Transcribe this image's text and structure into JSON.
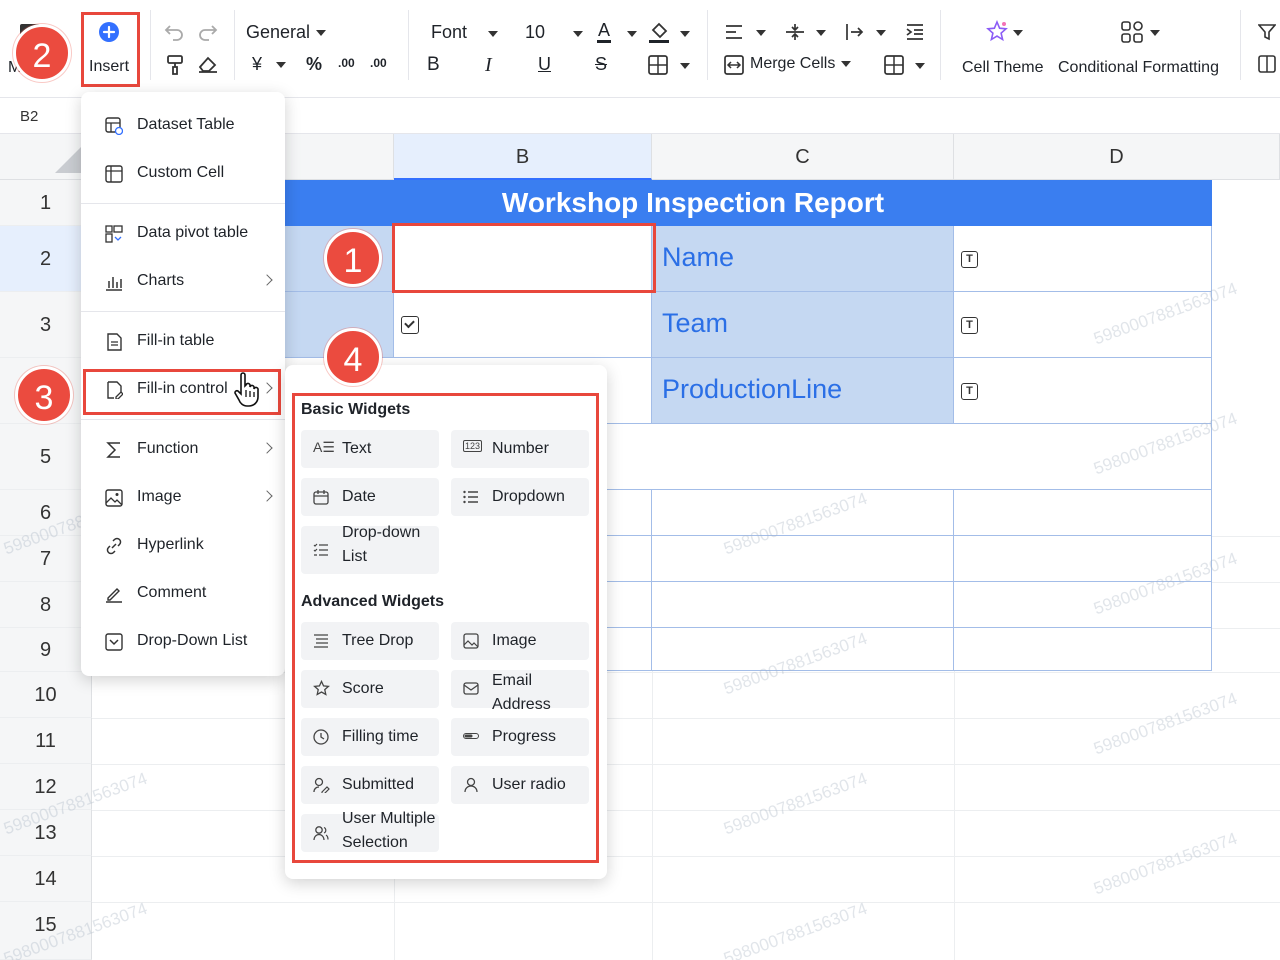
{
  "toolbar": {
    "insert_label": "Insert",
    "m_label": "M",
    "number_format": "General",
    "currency_symbol": "¥",
    "percent_symbol": "%",
    "decimal_decrease": ".00",
    "decimal_increase": ".00",
    "font": "Font",
    "font_size": "10",
    "bold": "B",
    "italic": "I",
    "underline": "U",
    "strike": "S",
    "font_color_letter": "A",
    "merge_cells": "Merge Cells",
    "cell_theme": "Cell Theme",
    "conditional_formatting": "Conditional Formatting"
  },
  "namebox": "B2",
  "columns": [
    "B",
    "C",
    "D"
  ],
  "rows": [
    "1",
    "2",
    "3",
    "5",
    "6",
    "7",
    "8",
    "9",
    "10",
    "11",
    "12",
    "13",
    "14",
    "15"
  ],
  "sheet": {
    "title": "Workshop Inspection Report",
    "labels": [
      "Name",
      "Team",
      "ProductionLine"
    ],
    "watermark": "5980007881563074"
  },
  "insert_menu": {
    "items": [
      {
        "label": "Dataset Table"
      },
      {
        "label": "Custom Cell"
      },
      {
        "label": "Data pivot table"
      },
      {
        "label": "Charts"
      },
      {
        "label": "Fill-in table"
      },
      {
        "label": "Fill-in control"
      },
      {
        "label": "Function"
      },
      {
        "label": "Image"
      },
      {
        "label": "Hyperlink"
      },
      {
        "label": "Comment"
      },
      {
        "label": "Drop-Down List"
      }
    ]
  },
  "fill_in_control": {
    "basic_heading": "Basic Widgets",
    "basic": [
      "Text",
      "Number",
      "Date",
      "Dropdown",
      "Drop-down List"
    ],
    "advanced_heading": "Advanced Widgets",
    "advanced": [
      "Tree Drop",
      "Image",
      "Score",
      "Email Address",
      "Filling time",
      "Progress",
      "Submitted",
      "User radio",
      "User Multiple Selection"
    ]
  },
  "badges": [
    "1",
    "2",
    "3",
    "4"
  ],
  "colors": {
    "accent": "#3370ff",
    "title_bar": "#3a7ef0",
    "label_text": "#2b6fe6",
    "highlight": "#e8473c",
    "badge": "#eb4b3f"
  }
}
